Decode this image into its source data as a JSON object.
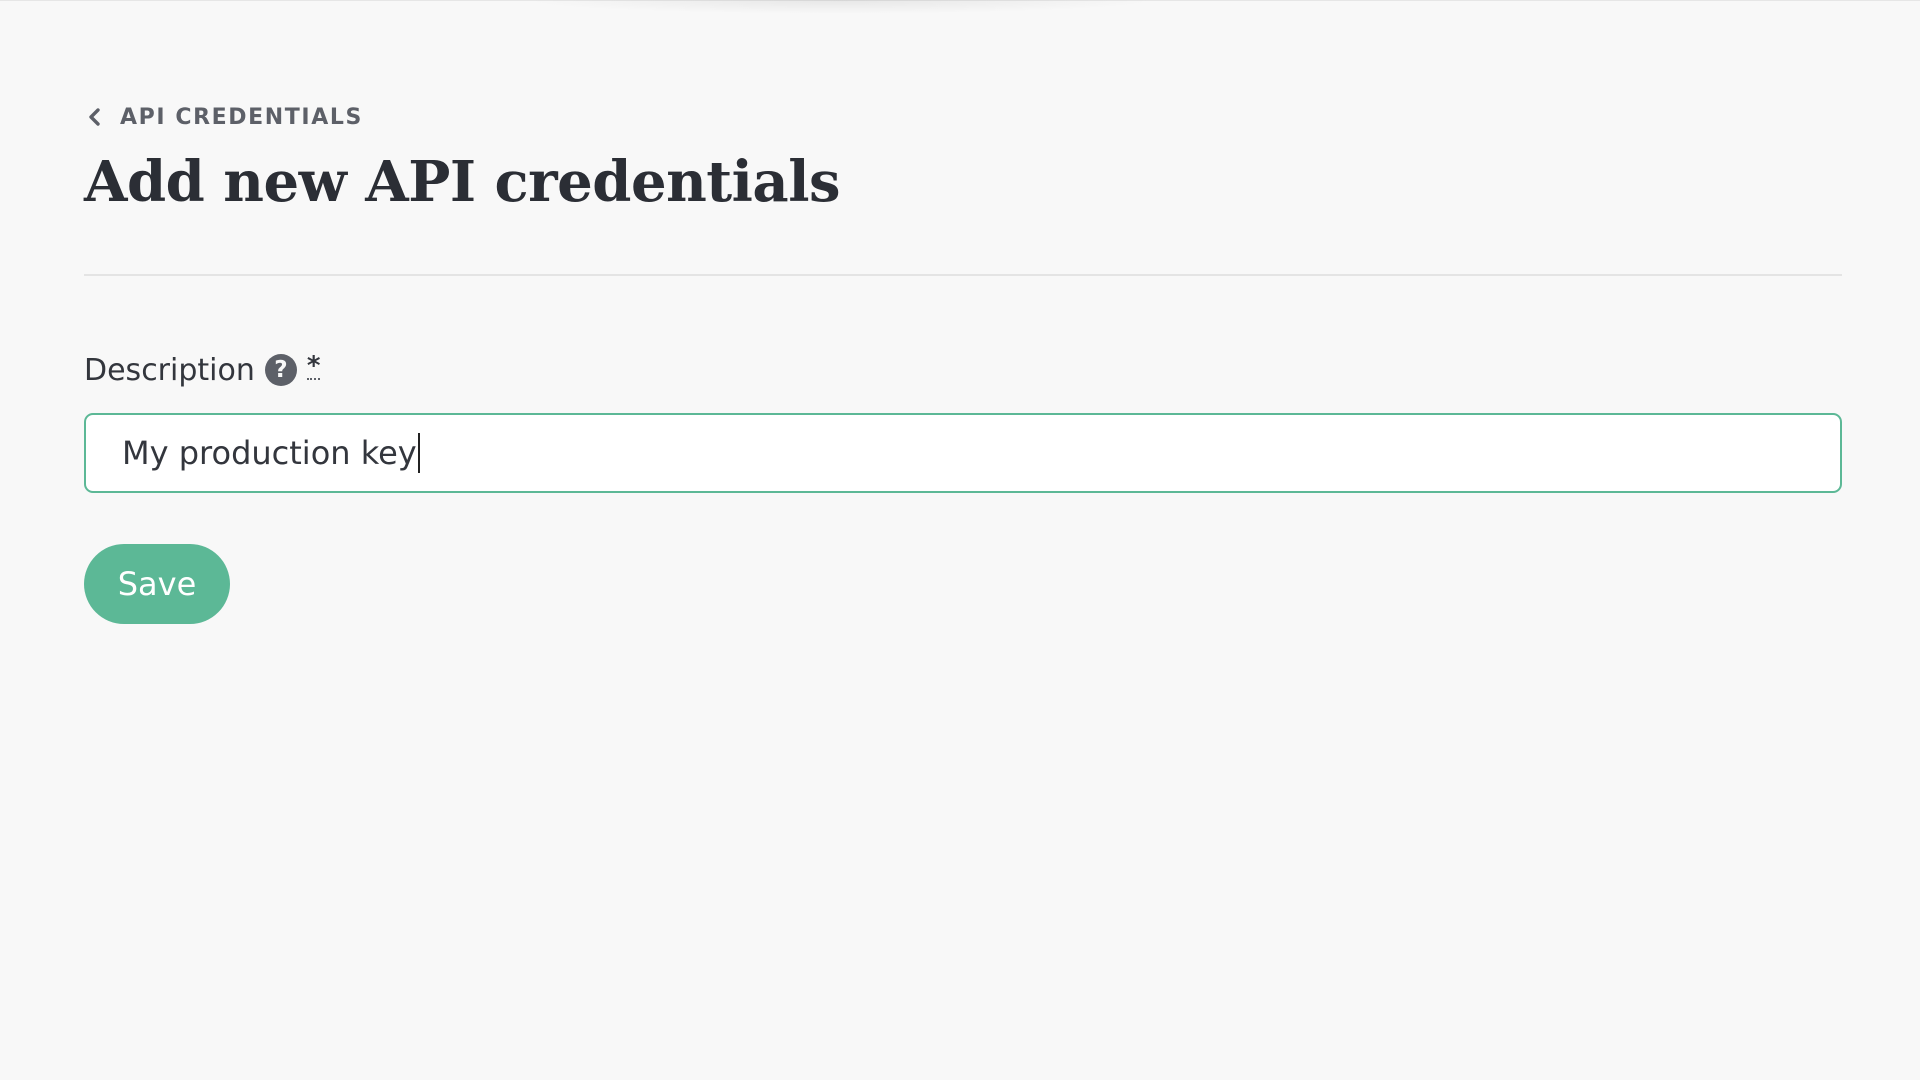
{
  "breadcrumb": {
    "icon": "chevron-left-icon",
    "label": "API CREDENTIALS"
  },
  "page": {
    "title": "Add new API credentials"
  },
  "form": {
    "description": {
      "label": "Description",
      "help_icon": "question-circle-icon",
      "help_glyph": "?",
      "required_marker": "*",
      "value": "My production key"
    },
    "save_label": "Save"
  },
  "colors": {
    "accent": "#5cb896",
    "background": "#f8f8f8",
    "text": "#2e3138",
    "muted": "#5d6068"
  }
}
